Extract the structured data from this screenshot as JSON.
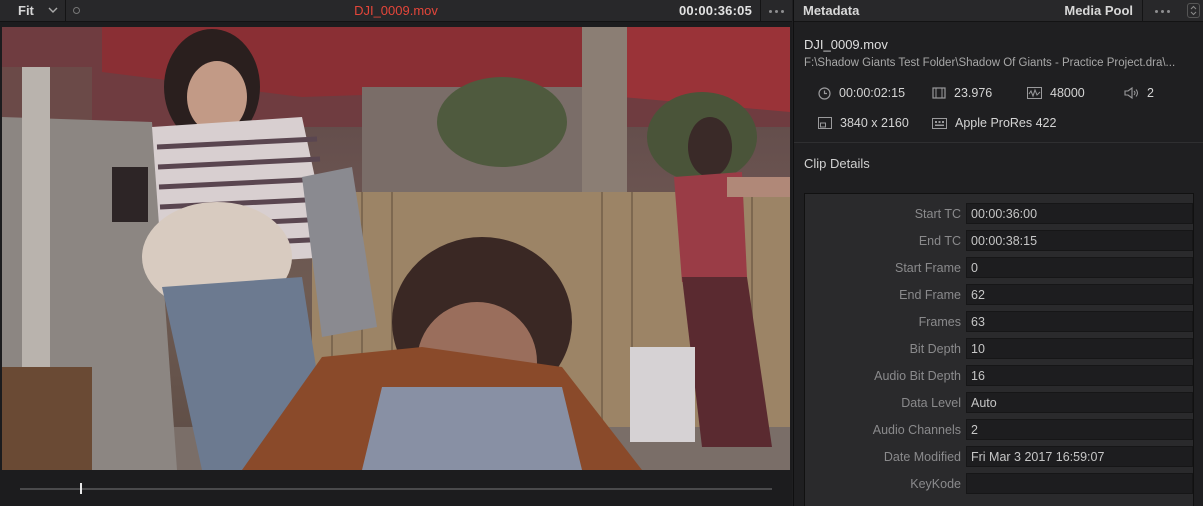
{
  "viewer": {
    "zoom_value": "Fit",
    "clip_name": "DJI_0009.mov",
    "timecode": "00:00:36:05"
  },
  "panel": {
    "title": "Metadata",
    "tab": "Media Pool"
  },
  "file": {
    "name": "DJI_0009.mov",
    "path": "F:\\Shadow Giants Test Folder\\Shadow Of Giants - Practice Project.dra\\..."
  },
  "summary": {
    "duration": "00:00:02:15",
    "fps": "23.976",
    "sample_rate": "48000",
    "audio_channels": "2",
    "resolution": "3840 x 2160",
    "codec": "Apple ProRes 422"
  },
  "clip_details": {
    "title": "Clip Details",
    "rows": [
      {
        "label": "Start TC",
        "value": "00:00:36:00"
      },
      {
        "label": "End TC",
        "value": "00:00:38:15"
      },
      {
        "label": "Start Frame",
        "value": "0"
      },
      {
        "label": "End Frame",
        "value": "62"
      },
      {
        "label": "Frames",
        "value": "63"
      },
      {
        "label": "Bit Depth",
        "value": "10"
      },
      {
        "label": "Audio Bit Depth",
        "value": "16"
      },
      {
        "label": "Data Level",
        "value": "Auto"
      },
      {
        "label": "Audio Channels",
        "value": "2"
      },
      {
        "label": "Date Modified",
        "value": "Fri Mar 3 2017 16:59:07"
      },
      {
        "label": "KeyKode",
        "value": ""
      }
    ]
  },
  "colors": {
    "clip_name_accent": "#e4463a",
    "panel_bg": "#1f1f21",
    "field_bg": "#1d1d1f"
  },
  "playhead_fraction": 0.08
}
